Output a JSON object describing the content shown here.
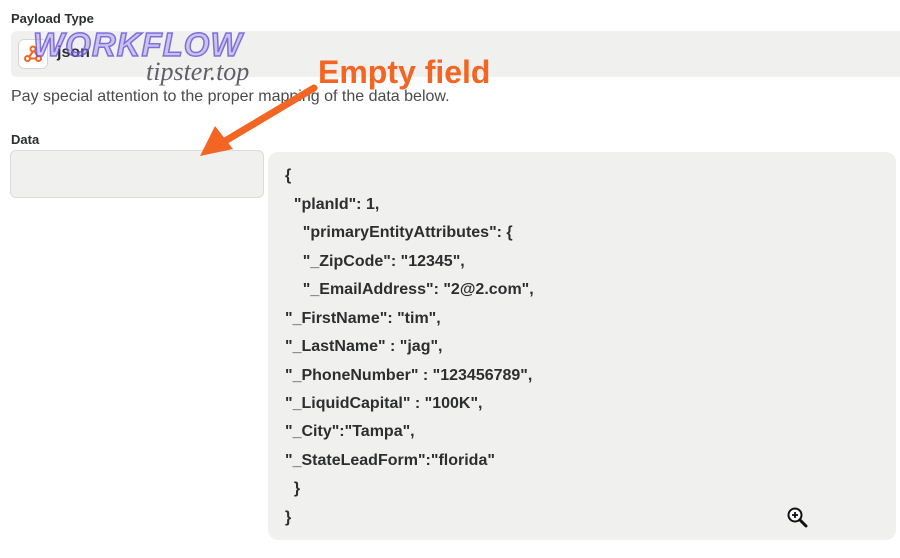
{
  "payload": {
    "label": "Payload Type",
    "value": "json",
    "icon": "webhook-icon"
  },
  "help_text": "Pay special attention to the proper mapping of the data below.",
  "data": {
    "label": "Data",
    "input_value": ""
  },
  "code_lines": [
    "{",
    "  \"planId\": 1,",
    "    \"primaryEntityAttributes\": {",
    "    \"_ZipCode\": \"12345\",",
    "    \"_EmailAddress\": \"2@2.com\",",
    "\"_FirstName\": \"tim\",",
    "\"_LastName\" : \"jag\",",
    "\"_PhoneNumber\" : \"123456789\",",
    "\"_LiquidCapital\" : \"100K\",",
    "\"_City\":\"Tampa\",",
    "\"_StateLeadForm\":\"florida\"",
    "  }",
    "}"
  ],
  "annotation": {
    "text": "Empty field",
    "color": "#f26522"
  },
  "watermark": {
    "title": "WORKFLOW",
    "subtitle": "tipster.top"
  },
  "colors": {
    "field_bg": "#f0f0ef",
    "accent": "#f26522",
    "text": "#2d2e2e"
  }
}
